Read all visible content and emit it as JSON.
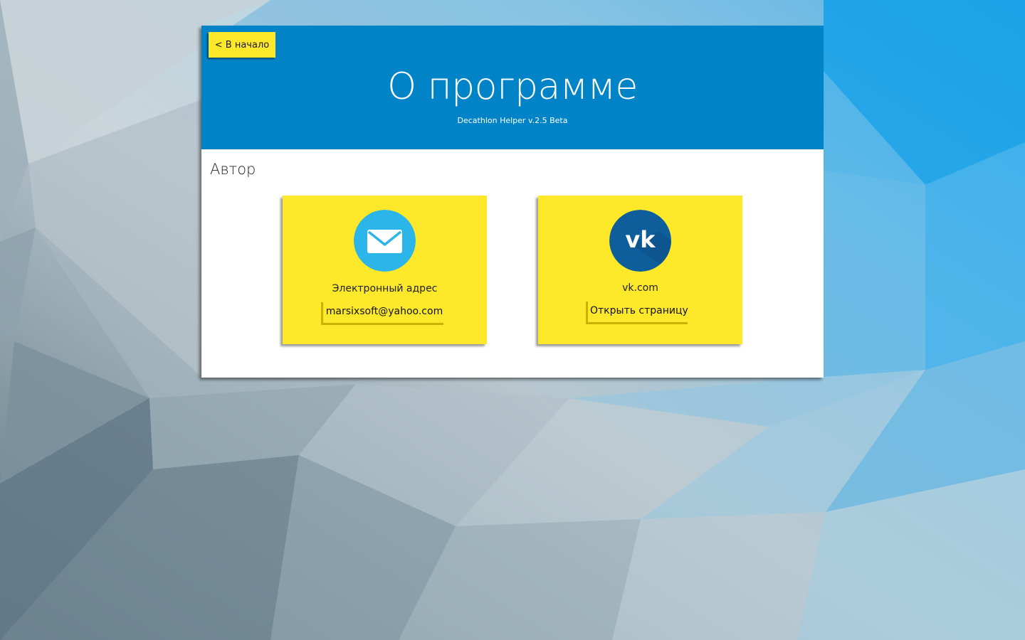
{
  "header": {
    "back_label": "< В начало",
    "title": "О программе",
    "version": "Decathlon Helper v.2.5 Beta",
    "color": "#0083c7"
  },
  "section": {
    "title": "Автор"
  },
  "cards": {
    "email": {
      "icon": "mail-icon",
      "label": "Электронный адрес",
      "button_label": "marsixsoft@yahoo.com",
      "icon_color": "#2bb5e8"
    },
    "vk": {
      "icon": "vk-icon",
      "label": "vk.com",
      "button_label": "Открыть страницу",
      "icon_color": "#0f5e9c"
    },
    "background_color": "#fde82a"
  }
}
